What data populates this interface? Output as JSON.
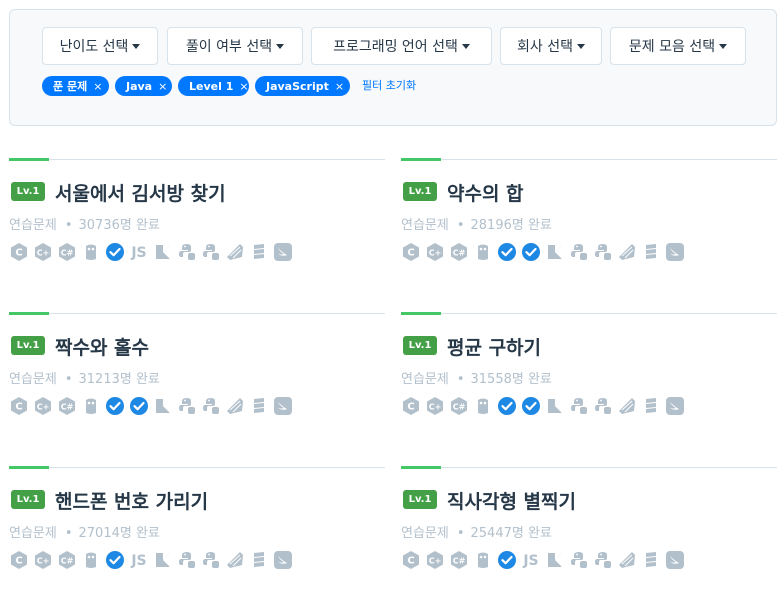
{
  "filters": {
    "dropdowns": [
      {
        "label": "난이도 선택"
      },
      {
        "label": "풀이 여부 선택"
      },
      {
        "label": "프로그래밍 언어 선택"
      },
      {
        "label": "회사 선택"
      },
      {
        "label": "문제 모음 선택"
      }
    ],
    "chips": [
      {
        "label": "푼 문제",
        "remove": "×"
      },
      {
        "label": "Java",
        "remove": "×"
      },
      {
        "label": "Level 1",
        "remove": "×"
      },
      {
        "label": "JavaScript",
        "remove": "×"
      }
    ],
    "reset_label": "필터 초기화"
  },
  "problems": [
    {
      "level": "Lv.1",
      "title": "서울에서 김서방 찾기",
      "category": "연습문제",
      "solved": "30736명 완료",
      "langs": [
        "c-icon",
        "cpp-icon",
        "csharp-icon",
        "go-icon",
        "check-icon",
        "js-icon",
        "kotlin-icon",
        "python2-icon",
        "python3-icon",
        "ruby-icon",
        "scala-icon",
        "swift-icon"
      ]
    },
    {
      "level": "Lv.1",
      "title": "약수의 합",
      "category": "연습문제",
      "solved": "28196명 완료",
      "langs": [
        "c-icon",
        "cpp-icon",
        "csharp-icon",
        "go-icon",
        "check-icon",
        "check-icon",
        "kotlin-icon",
        "python2-icon",
        "python3-icon",
        "ruby-icon",
        "scala-icon",
        "swift-icon"
      ]
    },
    {
      "level": "Lv.1",
      "title": "짝수와 홀수",
      "category": "연습문제",
      "solved": "31213명 완료",
      "langs": [
        "c-icon",
        "cpp-icon",
        "csharp-icon",
        "go-icon",
        "check-icon",
        "check-icon",
        "kotlin-icon",
        "python2-icon",
        "python3-icon",
        "ruby-icon",
        "scala-icon",
        "swift-icon"
      ]
    },
    {
      "level": "Lv.1",
      "title": "평균 구하기",
      "category": "연습문제",
      "solved": "31558명 완료",
      "langs": [
        "c-icon",
        "cpp-icon",
        "csharp-icon",
        "go-icon",
        "check-icon",
        "check-icon",
        "kotlin-icon",
        "python2-icon",
        "python3-icon",
        "ruby-icon",
        "scala-icon",
        "swift-icon"
      ]
    },
    {
      "level": "Lv.1",
      "title": "핸드폰 번호 가리기",
      "category": "연습문제",
      "solved": "27014명 완료",
      "langs": [
        "c-icon",
        "cpp-icon",
        "csharp-icon",
        "go-icon",
        "check-icon",
        "js-icon",
        "kotlin-icon",
        "python2-icon",
        "python3-icon",
        "ruby-icon",
        "scala-icon",
        "swift-icon"
      ]
    },
    {
      "level": "Lv.1",
      "title": "직사각형 별찍기",
      "category": "연습문제",
      "solved": "25447명 완료",
      "langs": [
        "c-icon",
        "cpp-icon",
        "csharp-icon",
        "go-icon",
        "check-icon",
        "js-icon",
        "kotlin-icon",
        "python2-icon",
        "python3-icon",
        "ruby-icon",
        "scala-icon",
        "swift-icon"
      ]
    }
  ],
  "icon_text": {
    "c": "C",
    "cpp": "C+",
    "csharp": "C#",
    "js": "JS"
  },
  "colors": {
    "accent_blue": "#0078ff",
    "level_green": "#44a046",
    "accent_line": "#44c767",
    "icon_gray": "#b2c0cc",
    "check_blue": "#1e88e5"
  }
}
